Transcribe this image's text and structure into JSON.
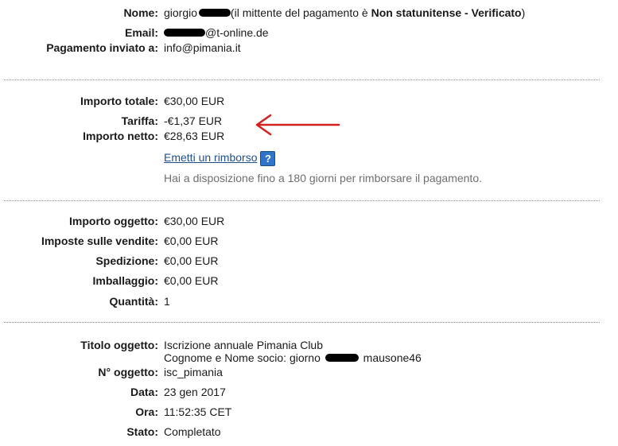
{
  "sender": {
    "name_label": "Nome:",
    "name_first": "giorgio",
    "status_prefix": "(il mittente del pagamento è ",
    "status_bold": "Non statunitense - Verificato",
    "status_suffix": ")",
    "email_label": "Email:",
    "email_domain": "@t-online.de",
    "recipient_label": "Pagamento inviato a:",
    "recipient_value": "info@pimania.it"
  },
  "amounts": {
    "total_label": "Importo totale:",
    "total_value": "€30,00 EUR",
    "fee_label": "Tariffa:",
    "fee_value": "-€1,37 EUR",
    "net_label": "Importo netto:",
    "net_value": "€28,63 EUR",
    "refund_link": "Emetti un rimborso",
    "help_icon": "question-mark",
    "refund_note": "Hai a disposizione fino a 180 giorni per rimborsare il pagamento.",
    "arrow_color": "#d42020"
  },
  "details": {
    "item_amount_label": "Importo oggetto:",
    "item_amount_value": "€30,00 EUR",
    "tax_label": "Imposte sulle vendite:",
    "tax_value": "€0,00 EUR",
    "shipping_label": "Spedizione:",
    "shipping_value": "€0,00 EUR",
    "packaging_label": "Imballaggio:",
    "packaging_value": "€0,00 EUR",
    "quantity_label": "Quantità:",
    "quantity_value": "1"
  },
  "item": {
    "title_label": "Titolo oggetto:",
    "title_line1": "Iscrizione annuale Pimania Club",
    "title_line2_prefix": "Cognome e Nome socio: giorno",
    "title_line2_suffix": "mausone46",
    "number_label": "N° oggetto:",
    "number_value": "isc_pimania",
    "date_label": "Data:",
    "date_value": "23 gen 2017",
    "time_label": "Ora:",
    "time_value": "11:52:35 CET",
    "status_label": "Stato:",
    "status_value": "Completato"
  }
}
